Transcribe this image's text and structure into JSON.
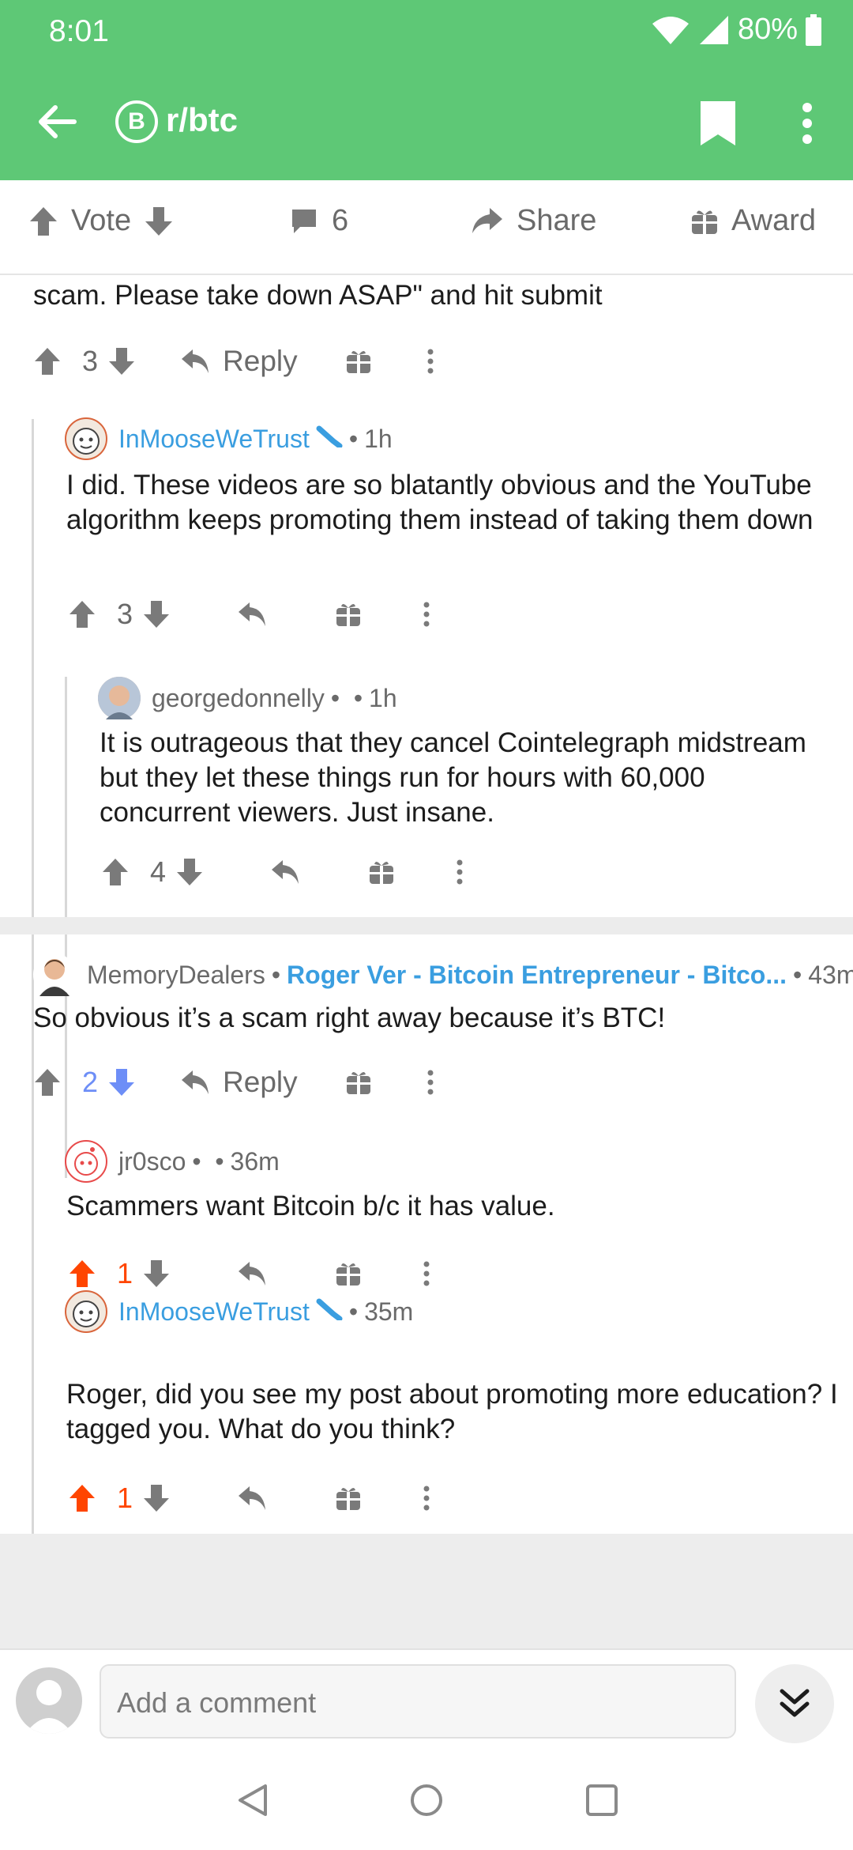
{
  "status_bar": {
    "time": "8:01",
    "battery": "80%"
  },
  "app_bar": {
    "subreddit": "r/btc",
    "subreddit_icon_letter": "B"
  },
  "post_actions": {
    "vote_label": "Vote",
    "comment_count": "6",
    "share_label": "Share",
    "award_label": "Award"
  },
  "partial_comment": {
    "text": "scam. Please take down ASAP\" and hit submit",
    "votes": "3",
    "reply_label": "Reply"
  },
  "comments": [
    {
      "user": "InMooseWeTrust",
      "time": "1h",
      "text": "I did. These videos are so blatantly obvious and the YouTube algorithm keeps promoting them instead of taking them down",
      "votes": "3"
    },
    {
      "user": "georgedonnelly",
      "time": "1h",
      "text": "It is outrageous that they cancel Cointelegraph midstream but they let these things run for hours with 60,000 concurrent viewers. Just insane.",
      "votes": "4"
    },
    {
      "user": "MemoryDealers",
      "flair": "Roger Ver - Bitcoin Entrepreneur - Bitco...",
      "time": "43m",
      "text": "So obvious it’s a scam right away because it’s BTC!",
      "votes": "2",
      "reply_label": "Reply"
    },
    {
      "user": "jr0sco",
      "time": "36m",
      "text": "Scammers want Bitcoin b/c it has value.",
      "votes": "1"
    },
    {
      "user": "InMooseWeTrust",
      "time": "35m",
      "text": "Roger, did you see my post about promoting more education? I tagged you. What do you think?",
      "votes": "1"
    }
  ],
  "composer": {
    "placeholder": "Add a comment"
  },
  "colors": {
    "brand_green": "#5ec876",
    "upvote_orange": "#ff4500",
    "downvote_blue": "#6d8ef7",
    "op_blue": "#3a9ee0"
  }
}
